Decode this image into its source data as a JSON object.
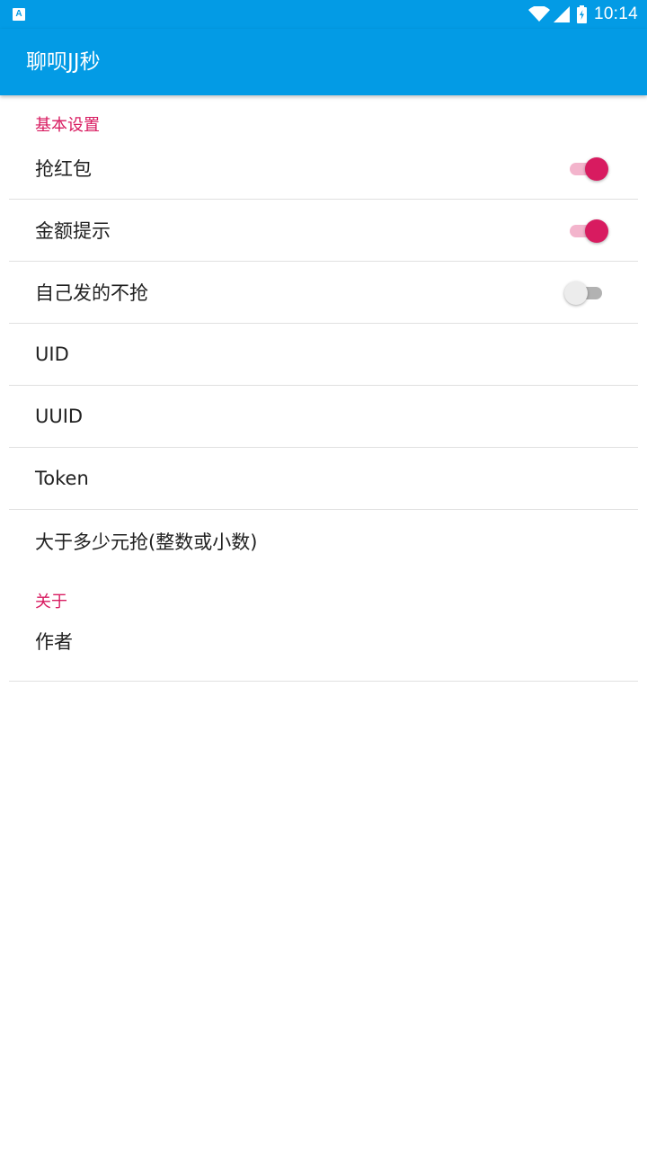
{
  "status_bar": {
    "left_icon_glyph": "A",
    "icons": [
      "wifi-icon",
      "cell-signal-icon",
      "battery-charging-icon"
    ],
    "time": "10:14"
  },
  "app_bar": {
    "title": "聊呗JJ秒",
    "color": "#039be5"
  },
  "sections": [
    {
      "header": "基本设置",
      "items": [
        {
          "label": "抢红包",
          "type": "switch",
          "checked": true
        },
        {
          "label": "金额提示",
          "type": "switch",
          "checked": true
        },
        {
          "label": "自己发的不抢",
          "type": "switch",
          "checked": false
        },
        {
          "label": "UID",
          "type": "text"
        },
        {
          "label": "UUID",
          "type": "text"
        },
        {
          "label": "Token",
          "type": "text"
        },
        {
          "label": "大于多少元抢(整数或小数)",
          "type": "text"
        }
      ]
    },
    {
      "header": "关于",
      "items": [
        {
          "label": "作者",
          "type": "text"
        }
      ]
    }
  ],
  "colors": {
    "accent": "#d81b60",
    "switch_track_on": "#f3b4cc",
    "switch_track_off": "#b2b2b2",
    "switch_thumb_off": "#ececec",
    "divider": "#e0e0e0"
  }
}
